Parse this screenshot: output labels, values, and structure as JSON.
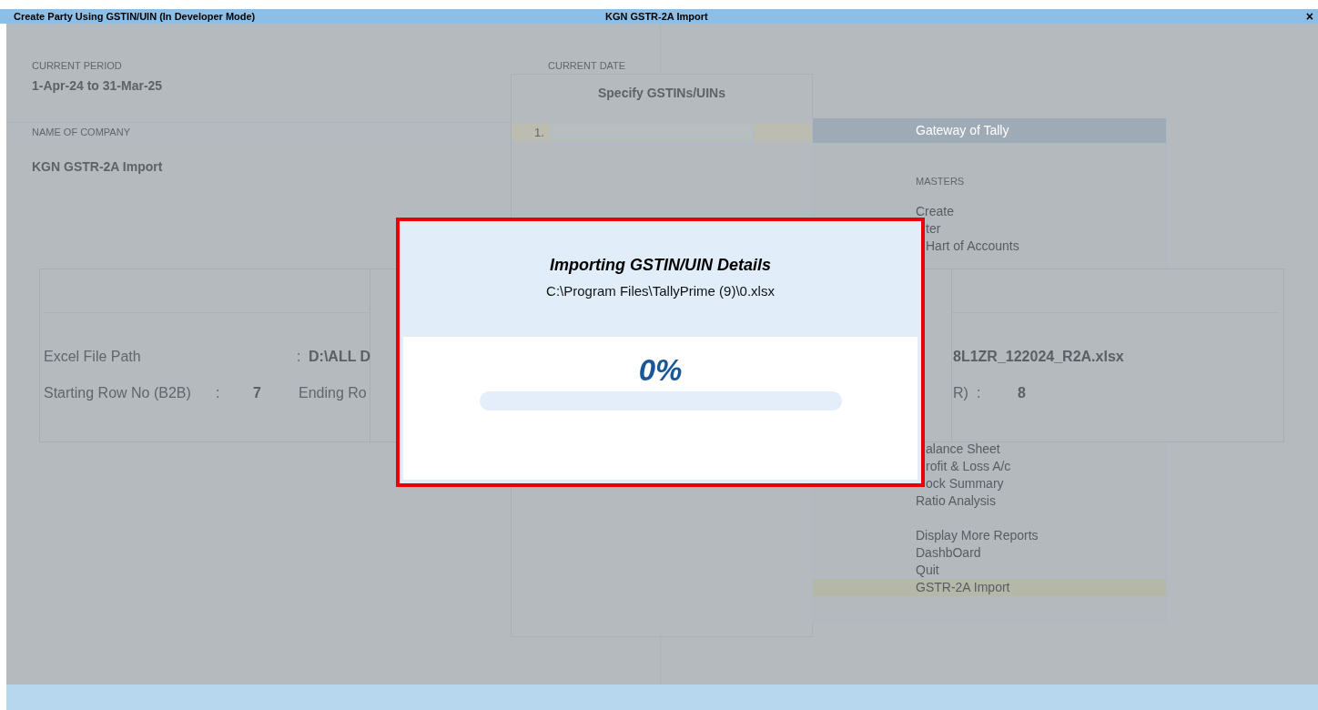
{
  "title_bar": {
    "left": "Create Party Using GSTIN/UIN (In Developer Mode)",
    "center": "KGN GSTR-2A Import",
    "close": "×"
  },
  "company_info": {
    "current_period_label": "CURRENT PERIOD",
    "current_period": "1-Apr-24 to 31-Mar-25",
    "current_date_label": "CURRENT DATE",
    "name_label": "NAME OF COMPANY",
    "company_name": "KGN GSTR-2A Import"
  },
  "gateway_menu": {
    "title": "Gateway of Tally",
    "groups": [
      {
        "heading": "MASTERS",
        "items": [
          {
            "label": "Create",
            "clipped": false,
            "selected": false
          },
          {
            "label": "ter",
            "clipped": true,
            "selected": false
          },
          {
            "label": "Hart of Accounts",
            "clipped": true,
            "selected": false
          }
        ]
      },
      {
        "items": [
          {
            "label": "alance Sheet",
            "clipped": true,
            "selected": false
          },
          {
            "label": "rofit & Loss A/c",
            "clipped": true,
            "selected": false
          },
          {
            "label": "ock Summary",
            "clipped": true,
            "selected": false
          },
          {
            "label": "Ratio Analysis",
            "clipped": false,
            "selected": false
          }
        ]
      },
      {
        "items": [
          {
            "label": "Display More Reports",
            "clipped": false,
            "selected": false
          },
          {
            "label": "DashbOard",
            "clipped": false,
            "selected": false
          },
          {
            "label": "Quit",
            "clipped": false,
            "selected": false
          },
          {
            "label": "GSTR-2A Import",
            "clipped": false,
            "selected": true
          }
        ]
      }
    ]
  },
  "gstin_panel": {
    "title": "Specify GSTINs/UINs",
    "rows": [
      {
        "number": "1.",
        "selected": true
      }
    ]
  },
  "excel_panel": {
    "file_path_label": "Excel File Path",
    "file_path_colon": ":",
    "file_path_value": "D:\\ALL D",
    "file_path_value_right": "8L1ZR_122024_R2A.xlsx",
    "start_row_label": "Starting Row No (B2B)",
    "start_row_colon": ":",
    "start_row_value": "7",
    "end_row_label": "Ending Ro",
    "end_row_label_right": "R)",
    "end_row_colon": ":",
    "end_row_value": "8"
  },
  "progress_dialog": {
    "title": "Importing GSTIN/UIN Details",
    "file_path": "C:\\Program Files\\TallyPrime (9)\\0.xlsx",
    "percent": "0%",
    "level": 0
  }
}
